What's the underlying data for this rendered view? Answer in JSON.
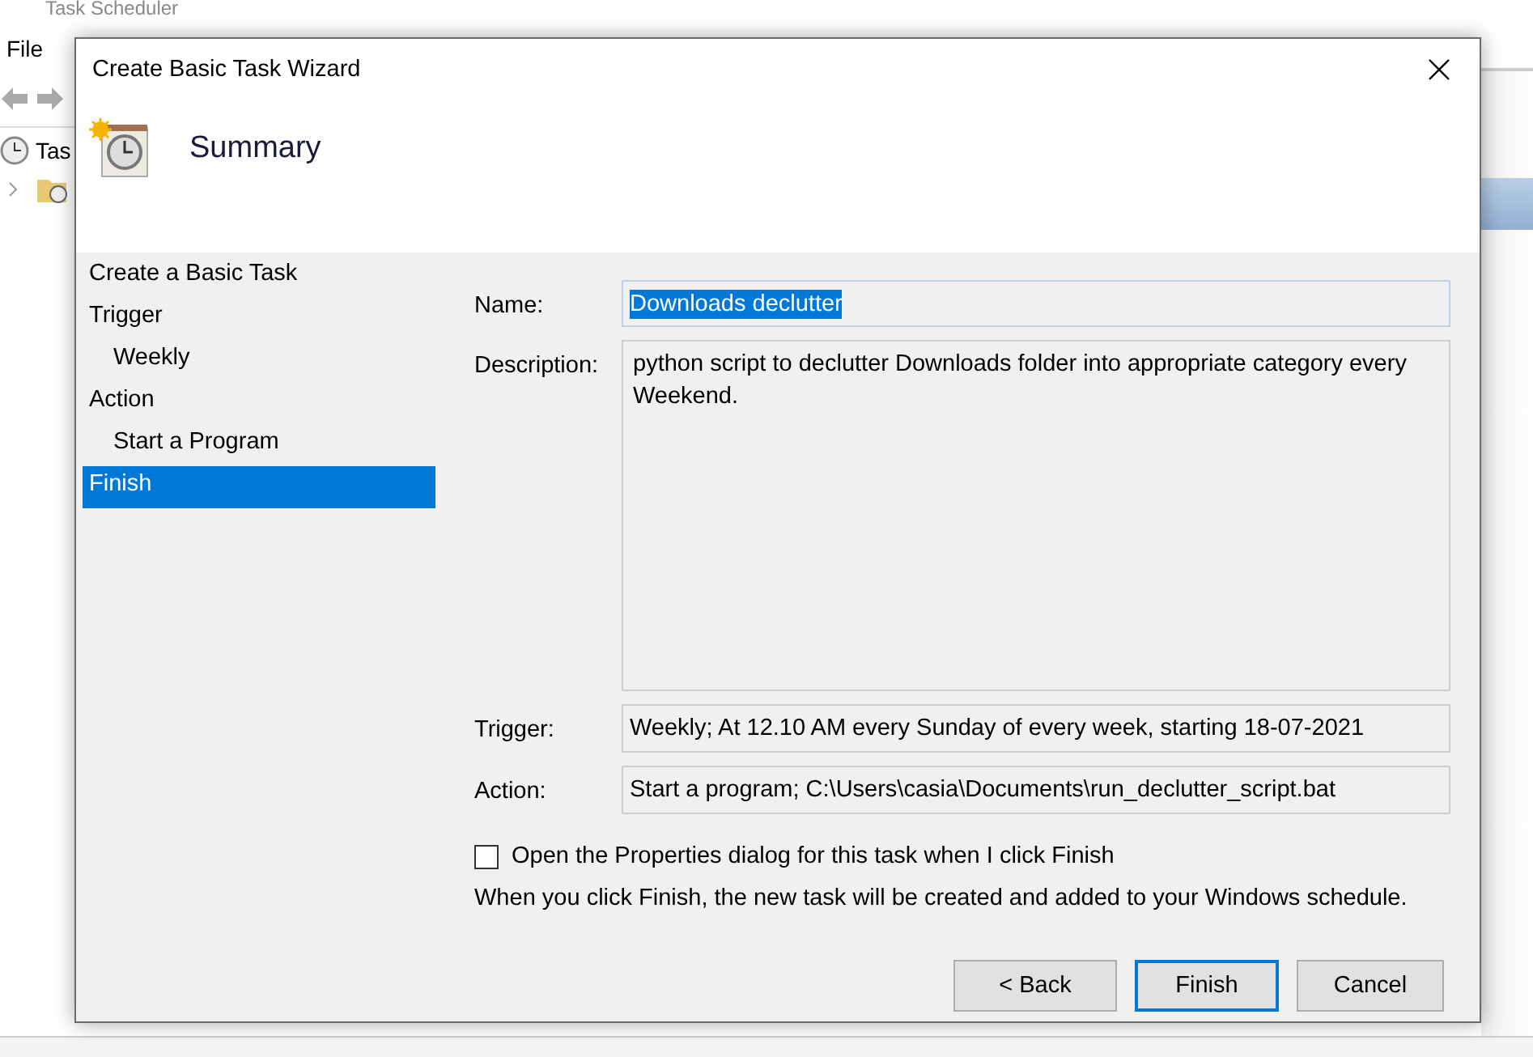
{
  "app": {
    "title": "Task Scheduler",
    "menu": [
      "File"
    ],
    "tree": [
      {
        "label": "Tas",
        "kind": "clock"
      },
      {
        "kind": "folder"
      }
    ]
  },
  "dialog": {
    "title": "Create Basic Task Wizard",
    "heading": "Summary",
    "nav": [
      {
        "label": "Create a Basic Task",
        "selected": false
      },
      {
        "label": "Trigger",
        "selected": false,
        "children": [
          {
            "label": "Weekly",
            "selected": false
          }
        ]
      },
      {
        "label": "Action",
        "selected": false,
        "children": [
          {
            "label": "Start a Program",
            "selected": false
          }
        ]
      },
      {
        "label": "Finish",
        "selected": true
      }
    ],
    "fields": [
      {
        "label": "Name:",
        "value": "Downloads declutter",
        "kind": "name",
        "value_selected": true
      },
      {
        "label": "Description:",
        "value": "python script to declutter Downloads folder into appropriate category every Weekend.",
        "kind": "description"
      },
      {
        "label": "Trigger:",
        "value": "Weekly; At 12.10 AM every Sunday of every week, starting 18-07-2021",
        "kind": "line"
      },
      {
        "label": "Action:",
        "value": "Start a program; C:\\Users\\casia\\Documents\\run_declutter_script.bat",
        "kind": "line"
      }
    ],
    "option": {
      "label": "Open the Properties dialog for this task when I click Finish",
      "checked": false
    },
    "info": "When you click Finish, the new task will be created and added to your Windows schedule.",
    "buttons": [
      {
        "label": "< Back",
        "default": false
      },
      {
        "label": "Finish",
        "default": true
      },
      {
        "label": "Cancel",
        "default": false
      }
    ]
  }
}
